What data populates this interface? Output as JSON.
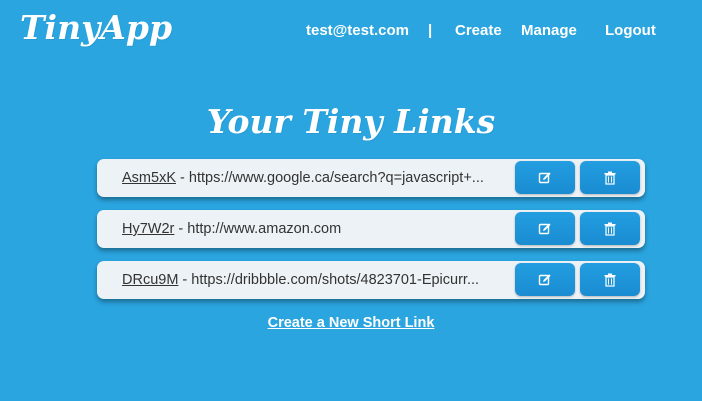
{
  "header": {
    "logo": "TinyApp",
    "user_email": "test@test.com",
    "separator": "|",
    "nav": {
      "create": "Create",
      "manage": "Manage",
      "logout": "Logout"
    }
  },
  "main": {
    "title": "Your Tiny Links",
    "links": [
      {
        "short": "Asm5xK",
        "dash": " - ",
        "long": "https://www.google.ca/search?q=javascript+..."
      },
      {
        "short": "Hy7W2r",
        "dash": " - ",
        "long": "http://www.amazon.com"
      },
      {
        "short": "DRcu9M",
        "dash": " - ",
        "long": "https://dribbble.com/shots/4823701-Epicurr..."
      }
    ],
    "create_new_label": "Create a New Short Link"
  },
  "icons": {
    "edit": "edit-icon",
    "delete": "trash-icon"
  },
  "colors": {
    "background": "#2aa5e0",
    "row_background": "#ecf2f6",
    "button": "#1a8cd2",
    "text": "#333333"
  }
}
